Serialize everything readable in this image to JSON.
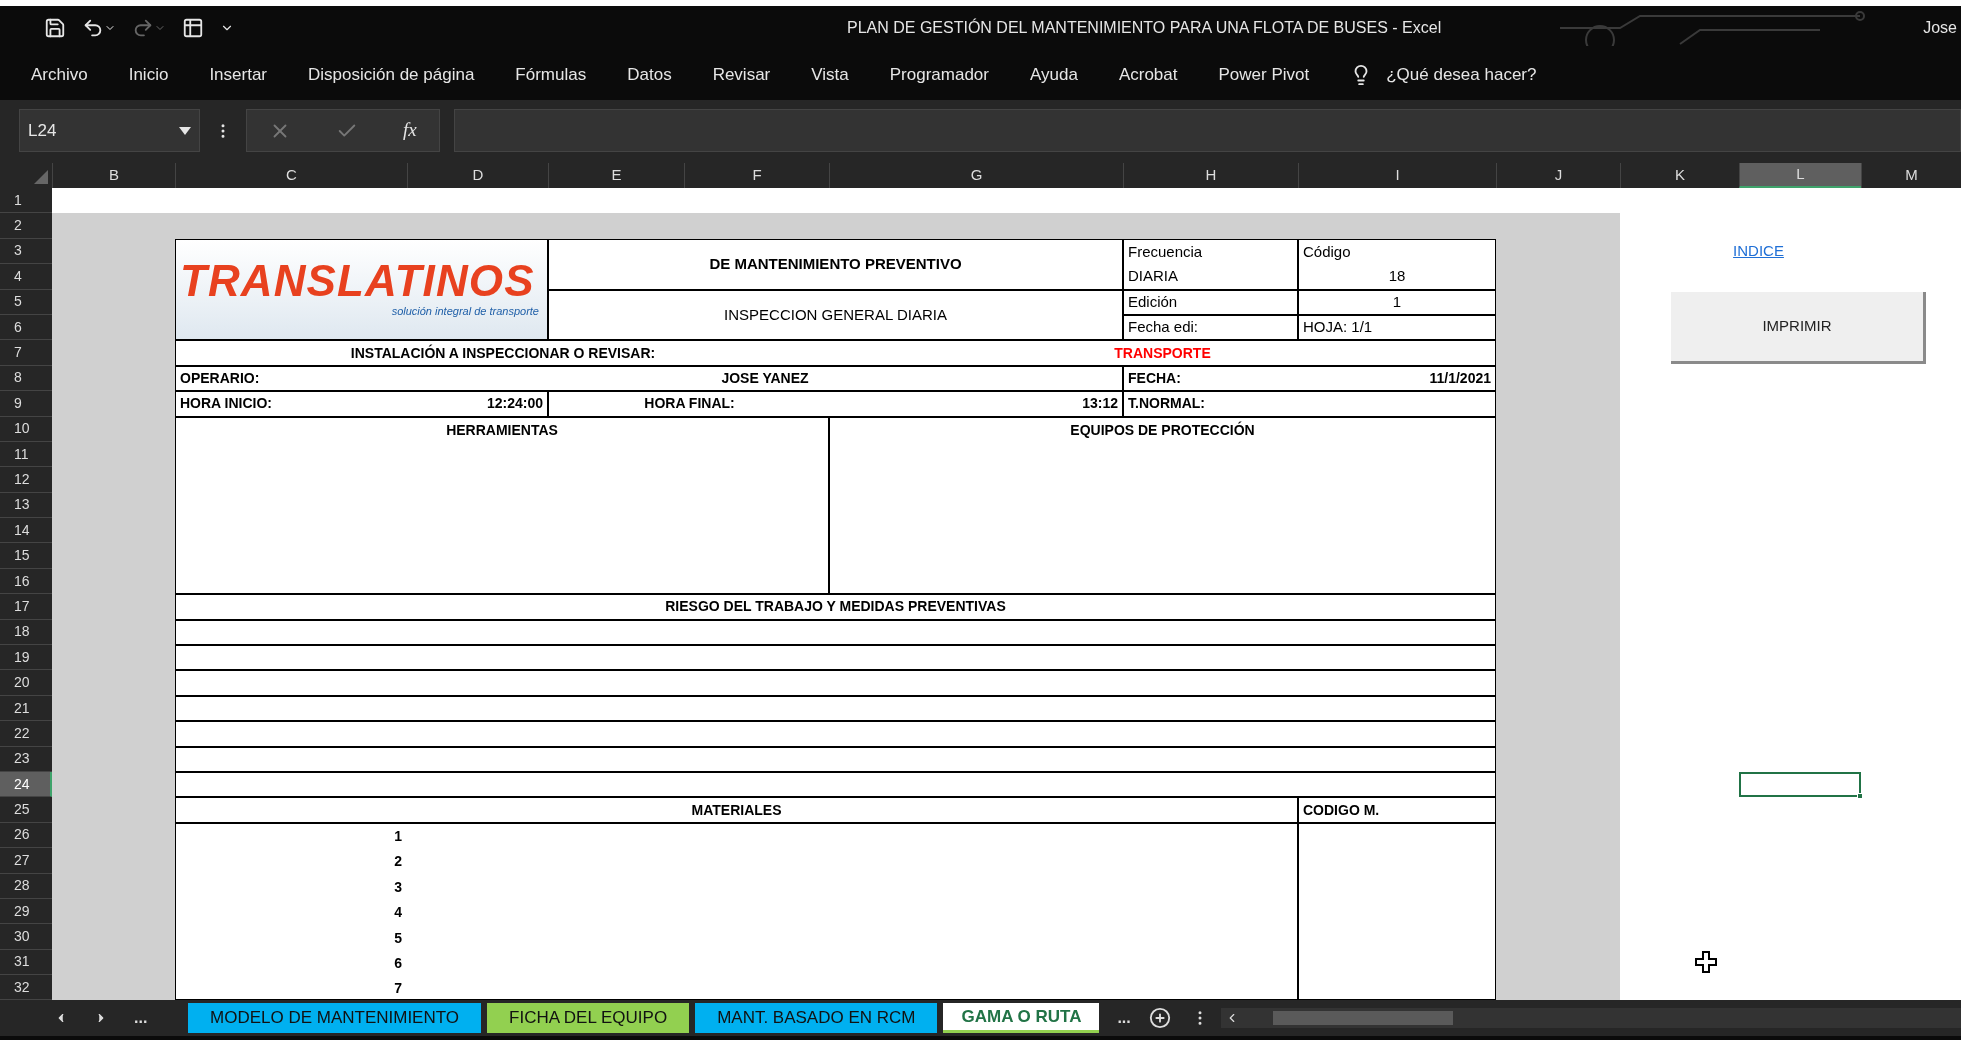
{
  "window": {
    "title": "PLAN DE GESTIÓN DEL MANTENIMIENTO PARA UNA FLOTA DE BUSES  -  Excel",
    "user": "Jose"
  },
  "ribbon_tabs": [
    "Archivo",
    "Inicio",
    "Insertar",
    "Disposición de página",
    "Fórmulas",
    "Datos",
    "Revisar",
    "Vista",
    "Programador",
    "Ayuda",
    "Acrobat",
    "Power Pivot"
  ],
  "tell_me": {
    "placeholder": "¿Qué desea hacer?"
  },
  "formula_bar": {
    "name_box": "L24",
    "function_label": "fx"
  },
  "column_headers": [
    {
      "label": "B",
      "selected": false
    },
    {
      "label": "C",
      "selected": false
    },
    {
      "label": "D",
      "selected": false
    },
    {
      "label": "E",
      "selected": false
    },
    {
      "label": "F",
      "selected": false
    },
    {
      "label": "G",
      "selected": false
    },
    {
      "label": "H",
      "selected": false
    },
    {
      "label": "I",
      "selected": false
    },
    {
      "label": "J",
      "selected": false
    },
    {
      "label": "K",
      "selected": false
    },
    {
      "label": "L",
      "selected": true
    },
    {
      "label": "M",
      "selected": false
    }
  ],
  "row_headers": [
    {
      "label": "1",
      "selected": false
    },
    {
      "label": "2",
      "selected": false
    },
    {
      "label": "3",
      "selected": false
    },
    {
      "label": "4",
      "selected": false
    },
    {
      "label": "5",
      "selected": false
    },
    {
      "label": "6",
      "selected": false
    },
    {
      "label": "7",
      "selected": false
    },
    {
      "label": "8",
      "selected": false
    },
    {
      "label": "9",
      "selected": false
    },
    {
      "label": "10",
      "selected": false
    },
    {
      "label": "11",
      "selected": false
    },
    {
      "label": "12",
      "selected": false
    },
    {
      "label": "13",
      "selected": false
    },
    {
      "label": "14",
      "selected": false
    },
    {
      "label": "15",
      "selected": false
    },
    {
      "label": "16",
      "selected": false
    },
    {
      "label": "17",
      "selected": false
    },
    {
      "label": "18",
      "selected": false
    },
    {
      "label": "19",
      "selected": false
    },
    {
      "label": "20",
      "selected": false
    },
    {
      "label": "21",
      "selected": false
    },
    {
      "label": "22",
      "selected": false
    },
    {
      "label": "23",
      "selected": false
    },
    {
      "label": "24",
      "selected": true
    },
    {
      "label": "25",
      "selected": false
    },
    {
      "label": "26",
      "selected": false
    },
    {
      "label": "27",
      "selected": false
    },
    {
      "label": "28",
      "selected": false
    },
    {
      "label": "29",
      "selected": false
    },
    {
      "label": "30",
      "selected": false
    },
    {
      "label": "31",
      "selected": false
    },
    {
      "label": "32",
      "selected": false
    }
  ],
  "form": {
    "logo": {
      "wordmark": "TRANSLATINOS",
      "tagline": "solución integral de transporte"
    },
    "title": "DE MANTENIMIENTO PREVENTIVO",
    "subtitle": "INSPECCION GENERAL DIARIA",
    "frequency_label": "Frecuencia",
    "frequency_value": "DIARIA",
    "code_label": "Código",
    "code_value": "18",
    "edition_label": "Edición",
    "edition_value": "1",
    "edit_date_label": "Fecha edi:",
    "sheet_number": "HOJA: 1/1",
    "installation_label": "INSTALACIÓN A INSPECCIONAR O REVISAR:",
    "installation_value": "TRANSPORTE",
    "operator_label": "OPERARIO:",
    "operator_value": "JOSE YANEZ",
    "date_label": "FECHA:",
    "date_value": "11/1/2021",
    "start_label": "HORA INICIO:",
    "start_value": "12:24:00",
    "end_label": "HORA FINAL:",
    "end_value": "13:12",
    "normal_time_label": "T.NORMAL:",
    "tools_heading": "HERRAMIENTAS",
    "protection_heading": "EQUIPOS DE PROTECCIÓN",
    "risk_heading": "RIESGO DEL TRABAJO Y MEDIDAS PREVENTIVAS",
    "materials_heading": "MATERIALES",
    "material_code_heading": "CODIGO M.",
    "material_numbers": [
      "1",
      "2",
      "3",
      "4",
      "5",
      "6",
      "7"
    ]
  },
  "index_link": "INDICE",
  "print_button": "IMPRIMIR",
  "tab_overflow_left": "...",
  "sheet_tabs": [
    {
      "label": "MODELO DE MANTENIMIENTO",
      "color": "#00b0f0",
      "selected": false
    },
    {
      "label": "FICHA DEL EQUIPO",
      "color": "#92d050",
      "selected": false
    },
    {
      "label": "MANT. BASADO EN RCM",
      "color": "#00b0f0",
      "selected": false
    },
    {
      "label": "GAMA O RUTA",
      "color": "#92d050",
      "selected": true
    }
  ],
  "tab_overflow_right": "..."
}
